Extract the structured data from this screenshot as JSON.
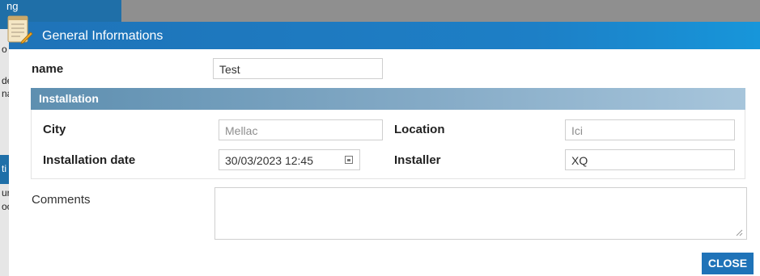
{
  "background": {
    "fragments": [
      "ng",
      "o",
      "de",
      "na",
      "ti",
      "ur",
      "oo"
    ]
  },
  "dialog": {
    "title": "General Informations",
    "name_label": "name",
    "name_value": "Test",
    "installation": {
      "header": "Installation",
      "city_label": "City",
      "city_value": "Mellac",
      "location_label": "Location",
      "location_value": "Ici",
      "date_label": "Installation date",
      "date_value": "30/03/2023 12:45",
      "installer_label": "Installer",
      "installer_value": "XQ"
    },
    "comments_label": "Comments",
    "comments_value": "",
    "close_label": "CLOSE"
  },
  "colors": {
    "titlebar": "#1f73b8",
    "section_header": "#6e9bbd",
    "close_button": "#1f73b8"
  },
  "icons": [
    "notepad-icon",
    "calendar-icon",
    "resize-grip-icon"
  ]
}
